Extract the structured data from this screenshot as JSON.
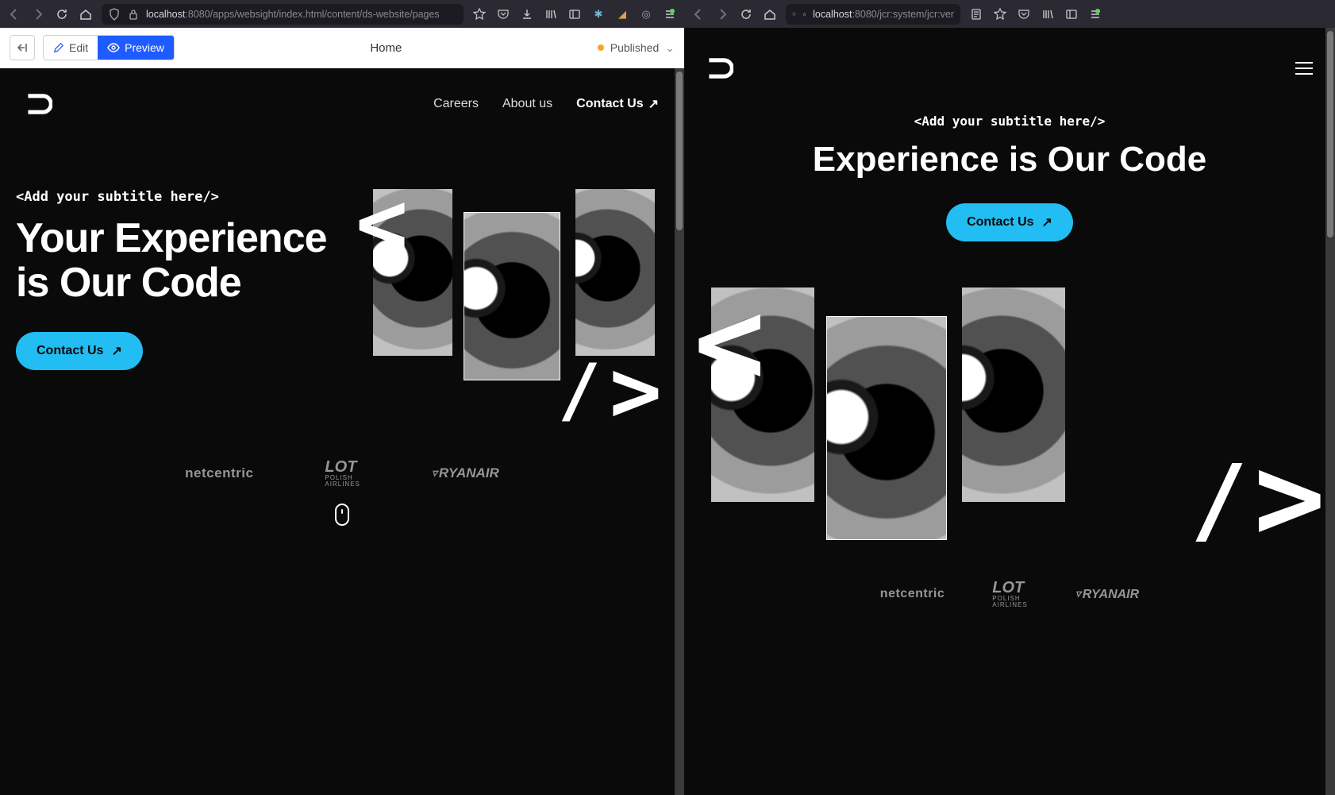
{
  "left_browser": {
    "url_prefix": "localhost",
    "url_rest": ":8080/apps/websight/index.html/content/ds-website/pages"
  },
  "right_browser": {
    "url_prefix": "localhost",
    "url_rest": ":8080/jcr:system/jcr:ver"
  },
  "cms": {
    "edit_label": "Edit",
    "preview_label": "Preview",
    "page_title": "Home",
    "status_label": "Published"
  },
  "site": {
    "nav": {
      "careers": "Careers",
      "about": "About us",
      "contact": "Contact Us"
    },
    "hero": {
      "subtitle": "<Add your subtitle here/>",
      "title_left": "Your Experience is Our Code",
      "title_right": "Experience is Our Code",
      "cta": "Contact Us"
    },
    "logos": {
      "netcentric": "netcentric",
      "lot_main": "LOT",
      "lot_sub": "POLISH\nAIRLINES",
      "ryanair": "RYANAIR"
    }
  }
}
